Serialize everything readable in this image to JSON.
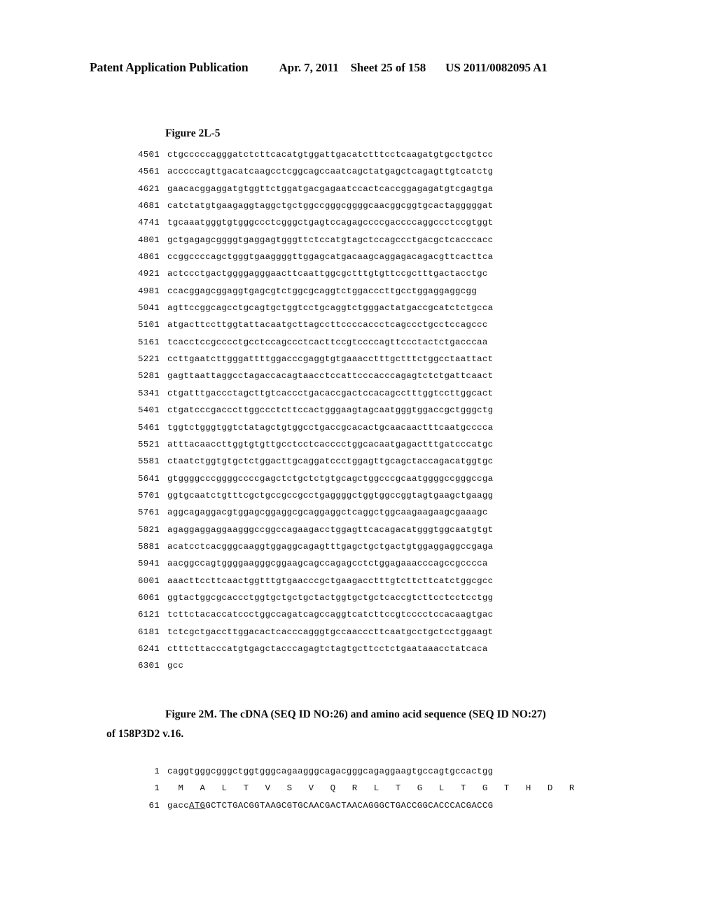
{
  "header": {
    "publication": "Patent Application Publication",
    "date": "Apr. 7, 2011",
    "sheet": "Sheet 25 of 158",
    "patent_number": "US 2011/0082095 A1"
  },
  "figure_2L5": {
    "label": "Figure 2L-5",
    "lines": [
      {
        "num": "4501",
        "bases": "ctgcccccagggatctcttcacatgtggattgacatctttcctcaagatgtgcctgctcc"
      },
      {
        "num": "4561",
        "bases": "acccccagttgacatcaagcctcggcagccaatcagctatgagctcagagttgtcatctg"
      },
      {
        "num": "4621",
        "bases": "gaacacggaggatgtggttctggatgacgagaatccactcaccggagagatgtcgagtga"
      },
      {
        "num": "4681",
        "bases": "catctatgtgaagaggtaggctgctggccgggcggggcaacggcggtgcactagggggat"
      },
      {
        "num": "4741",
        "bases": "tgcaaatgggtgtgggccctcgggctgagtccagagccccgaccccaggccctccgtggt"
      },
      {
        "num": "4801",
        "bases": "gctgagagcggggtgaggagtgggttctccatgtagctccagccctgacgctcacccacc"
      },
      {
        "num": "4861",
        "bases": "ccggccccagctgggtgaaggggttggagcatgacaagcaggagacagacgttcacttca"
      },
      {
        "num": "4921",
        "bases": "actccctgactggggagggaacttcaattggcgctttgtgttccgctttgactacctgc"
      },
      {
        "num": "4981",
        "bases": "ccacggagcggaggtgagcgtctggcgcaggtctggacccttgcctggaggaggcgg"
      },
      {
        "num": "5041",
        "bases": "agttccggcagcctgcagtgctggtcctgcaggtctgggactatgaccgcatctctgcca"
      },
      {
        "num": "5101",
        "bases": "atgacttccttggtattacaatgcttagccttccccaccctcagccctgcctccagccc"
      },
      {
        "num": "5161",
        "bases": "tcacctccgcccctgcctccagccctcacttccgtccccagttccctactctgacccaa"
      },
      {
        "num": "5221",
        "bases": "ccttgaatcttgggattttggacccgaggtgtgaaacctttgctttctggcctaattact"
      },
      {
        "num": "5281",
        "bases": "gagttaattaggcctagaccacagtaacctccattcccacccagagtctctgattcaact"
      },
      {
        "num": "5341",
        "bases": "ctgatttgaccctagcttgtcaccctgacaccgactccacagcctttggtccttggcact"
      },
      {
        "num": "5401",
        "bases": "ctgatcccgacccttggccctcttccactgggaagtagcaatgggtggaccgctgggctg"
      },
      {
        "num": "5461",
        "bases": "tggtctgggtggtctatagctgtggcctgaccgcacactgcaacaactttcaatgcccca"
      },
      {
        "num": "5521",
        "bases": "atttacaaccttggtgtgttgcctcctcacccctggcacaatgagactttgatcccatgc"
      },
      {
        "num": "5581",
        "bases": "ctaatctggtgtgctctggacttgcaggatccctggagttgcagctaccagacatggtgc"
      },
      {
        "num": "5641",
        "bases": "gtggggcccggggccccgagctctgctctgtgcagctggcccgcaatggggccgggccga"
      },
      {
        "num": "5701",
        "bases": "ggtgcaatctgtttcgctgccgccgcctgaggggctggtggccggtagtgaagctgaagg"
      },
      {
        "num": "5761",
        "bases": "aggcagaggacgtggagcggaggcgcaggaggctcaggctggcaagaagaagcgaaagc"
      },
      {
        "num": "5821",
        "bases": "agaggaggaggaagggccggccagaagacctggagttcacagacatgggtggcaatgtgt"
      },
      {
        "num": "5881",
        "bases": "acatcctcacgggcaaggtggaggcagagtttgagctgctgactgtggaggaggccgaga"
      },
      {
        "num": "5941",
        "bases": "aacggccagtggggaagggcggaagcagccagagcctctggagaaacccagccgcccca"
      },
      {
        "num": "6001",
        "bases": "aaacttccttcaactggtttgtgaacccgctgaagacctttgtcttcttcatctggcgcc"
      },
      {
        "num": "6061",
        "bases": "ggtactggcgcaccctggtgctgctgctactggtgctgctcaccgtcttcctcctcctgg"
      },
      {
        "num": "6121",
        "bases": "tcttctacaccatccctggccagatcagccaggtcatcttccgtcccctccacaagtgac"
      },
      {
        "num": "6181",
        "bases": "tctcgctgaccttggacactcacccagggtgccaacccttcaatgcctgctcctggaagt"
      },
      {
        "num": "6241",
        "bases": "ctttcttacccatgtgagctacccagagtctagtgcttcctctgaataaacctatcaca"
      },
      {
        "num": "6301",
        "bases": "gcc"
      }
    ]
  },
  "figure_2M": {
    "caption_line1": "Figure 2M.  The cDNA (SEQ ID NO:26) and amino acid sequence (SEQ ID NO:27)",
    "caption_line2": "of 158P3D2 v.16.",
    "lines": [
      {
        "type": "nucleotide",
        "num": "1",
        "bases": "caggtgggcgggctggtgggcagaagggcagacgggcagaggaagtgccagtgccactgg"
      },
      {
        "type": "amino_acid",
        "num": "1",
        "residues": "M   A   L   T   V   S   V   Q   R   L   T   G   L   T   G   T   H   D   R"
      },
      {
        "type": "nucleotide_with_start_codon",
        "num": "61",
        "prefix": "gacc",
        "start_codon": "ATG",
        "suffix": "GCTCTGACGGTAAGCGTGCAACGACTAACAGGGCTGACCGGCACCCACGACCG"
      }
    ]
  }
}
